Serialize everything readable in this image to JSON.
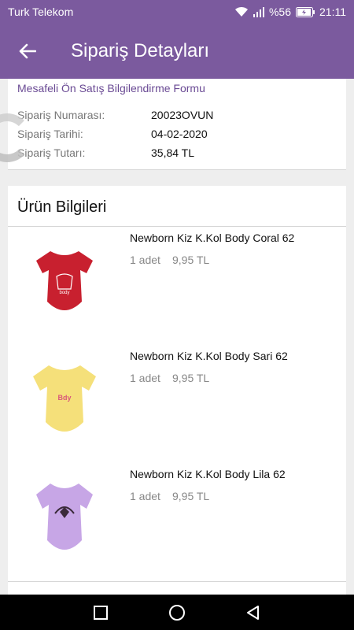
{
  "status_bar": {
    "carrier": "Turk Telekom",
    "battery": "%56",
    "time": "21:11",
    "icons": [
      "wifi-icon",
      "signal-icon",
      "battery-icon"
    ]
  },
  "header": {
    "title": "Sipariş Detayları",
    "back_icon": "arrow-left-icon"
  },
  "order": {
    "form_link": "Mesafeli Ön Satış Bilgilendirme Formu",
    "rows": [
      {
        "label": "Sipariş Numarası:",
        "value": "20023OVUN"
      },
      {
        "label": "Sipariş Tarihi:",
        "value": "04-02-2020"
      },
      {
        "label": "Sipariş Tutarı:",
        "value": "35,84 TL"
      }
    ]
  },
  "products": {
    "title": "Ürün Bilgileri",
    "items": [
      {
        "name": "Newborn Kiz K.Kol Body  Coral 62",
        "qty": "1 adet",
        "price": "9,95 TL",
        "color": "#c8202f"
      },
      {
        "name": "Newborn Kiz K.Kol Body  Sari  62",
        "qty": "1 adet",
        "price": "9,95 TL",
        "color": "#f5e07a"
      },
      {
        "name": "Newborn Kiz K.Kol Body  Lila 62",
        "qty": "1 adet",
        "price": "9,95 TL",
        "color": "#c7a6e6"
      }
    ]
  },
  "nav": [
    "square-recent-icon",
    "circle-home-icon",
    "triangle-back-icon"
  ],
  "colors": {
    "primary": "#7b5a9e",
    "link": "#6a4a94"
  }
}
